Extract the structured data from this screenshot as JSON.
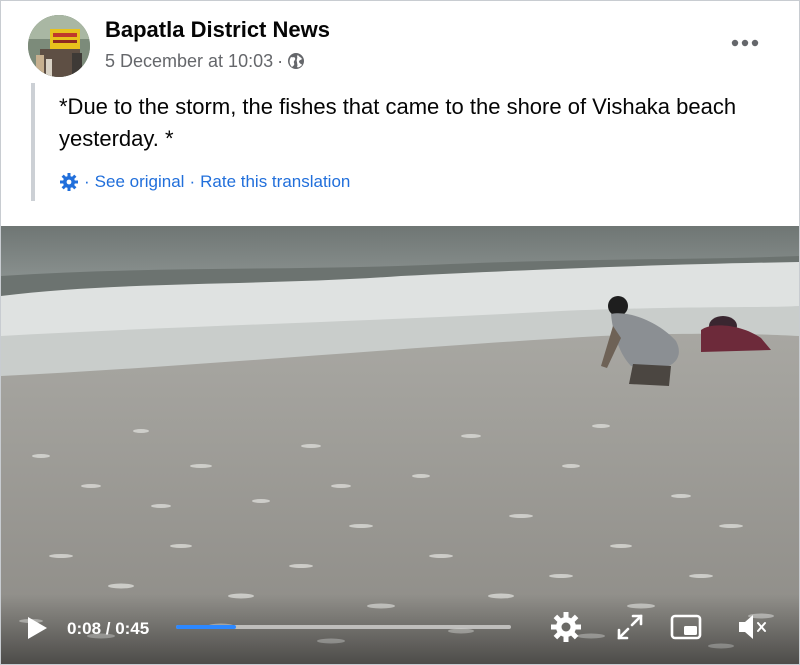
{
  "post": {
    "page_name": "Bapatla District News",
    "timestamp": "5 December at 10:03",
    "meta_separator": "·",
    "audience_icon": "globe-icon",
    "more_icon": "more-options-icon",
    "text": "*Due to the storm, the fishes that came to the shore of Vishaka beach yesterday. *",
    "translation": {
      "icon": "gear-icon",
      "see_original": "See original",
      "rate": "Rate this translation",
      "separator": "·"
    }
  },
  "video": {
    "current_time": "0:08",
    "duration": "0:45",
    "time_display": "0:08 / 0:45",
    "progress_fraction": 0.178,
    "progress_color": "#2d88ff",
    "controls": [
      "play-icon",
      "settings-icon",
      "fullscreen-icon",
      "picture-in-picture-icon",
      "mute-icon"
    ]
  },
  "colors": {
    "link": "#216fdb",
    "meta": "#65676b",
    "text": "#050505"
  }
}
